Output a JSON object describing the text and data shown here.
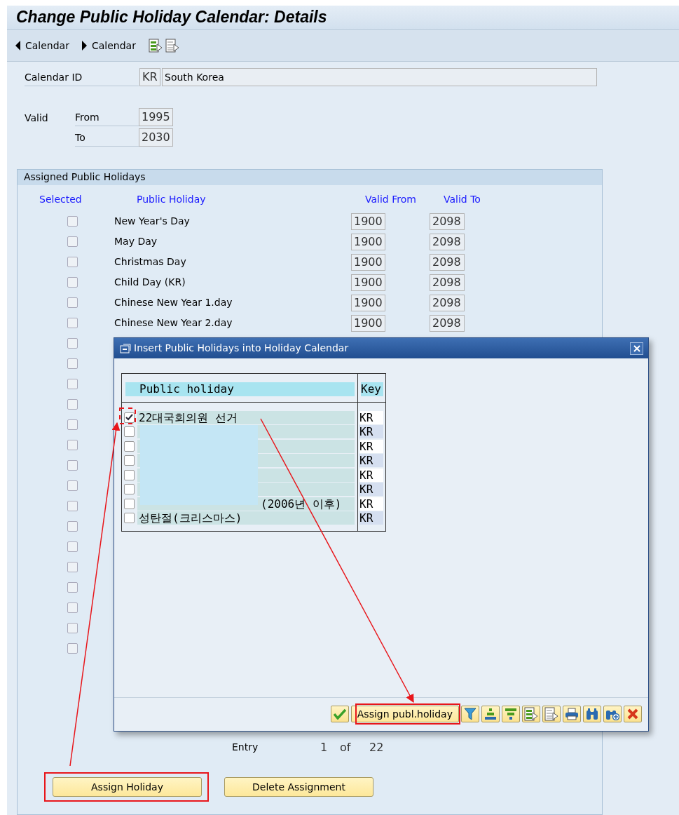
{
  "window": {
    "title": "Change Public Holiday Calendar: Details"
  },
  "toolbar": [
    {
      "kind": "prev",
      "label": "Calendar"
    },
    {
      "kind": "next",
      "label": "Calendar"
    },
    {
      "kind": "export"
    },
    {
      "kind": "doc"
    }
  ],
  "calendar_id": {
    "label": "Calendar ID",
    "code": "KR",
    "name": "South Korea"
  },
  "validity": {
    "label": "Valid",
    "from_label": "From",
    "from": "1995",
    "to_label": "To",
    "to": "2030"
  },
  "assigned": {
    "title": "Assigned Public Holidays",
    "columns": [
      "Selected",
      "Public Holiday",
      "Valid From",
      "Valid To"
    ],
    "rows": [
      {
        "selected": false,
        "name": "New Year's Day",
        "valid_from": "1900",
        "valid_to": "2098"
      },
      {
        "selected": false,
        "name": "May Day",
        "valid_from": "1900",
        "valid_to": "2098"
      },
      {
        "selected": false,
        "name": "Christmas Day",
        "valid_from": "1900",
        "valid_to": "2098"
      },
      {
        "selected": false,
        "name": "Child Day (KR)",
        "valid_from": "1900",
        "valid_to": "2098"
      },
      {
        "selected": false,
        "name": "Chinese New Year 1.day",
        "valid_from": "1900",
        "valid_to": "2098"
      },
      {
        "selected": false,
        "name": "Chinese New Year 2.day",
        "valid_from": "1900",
        "valid_to": "2098"
      },
      {
        "selected": false
      },
      {
        "selected": false
      },
      {
        "selected": false
      },
      {
        "selected": false
      },
      {
        "selected": false
      },
      {
        "selected": false
      },
      {
        "selected": false
      },
      {
        "selected": false
      },
      {
        "selected": false
      },
      {
        "selected": false
      },
      {
        "selected": false
      },
      {
        "selected": false
      },
      {
        "selected": false
      },
      {
        "selected": false
      },
      {
        "selected": false
      },
      {
        "selected": false
      }
    ]
  },
  "pager": {
    "label": "Entry",
    "current": "1",
    "of": "of",
    "total": "22"
  },
  "buttons": [
    "Assign Holiday",
    "Delete Assignment"
  ],
  "dialog": {
    "title": "Insert Public Holidays into Holiday Calendar",
    "columns": [
      "Public holiday",
      "Key"
    ],
    "rows": [
      {
        "selected": true,
        "name": "22대국회의원 선거",
        "key": "KR"
      },
      {
        "selected": false,
        "key": "KR"
      },
      {
        "selected": false,
        "key": "KR"
      },
      {
        "selected": false,
        "key": "KR"
      },
      {
        "selected": false,
        "key": "KR"
      },
      {
        "selected": false,
        "key": "KR"
      },
      {
        "selected": false,
        "name": "(2006년 이후)",
        "key": "KR"
      },
      {
        "selected": false,
        "name": "성탄절(크리스마스)",
        "key": "KR"
      }
    ],
    "buttons": [
      {
        "kind": "confirm"
      },
      {
        "kind": "text",
        "label": "Assign publ.holiday"
      },
      {
        "kind": "filter"
      },
      {
        "kind": "sort-up"
      },
      {
        "kind": "sort-down"
      },
      {
        "kind": "export"
      },
      {
        "kind": "doc"
      },
      {
        "kind": "print"
      },
      {
        "kind": "find"
      },
      {
        "kind": "find-next"
      },
      {
        "kind": "cancel"
      }
    ]
  }
}
